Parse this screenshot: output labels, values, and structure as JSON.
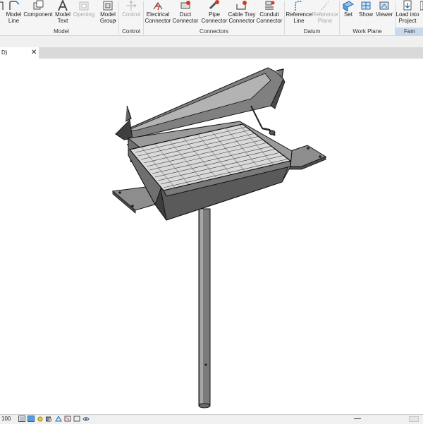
{
  "ribbon": {
    "buttons": {
      "model_line": "Model\nLine",
      "component": "Component",
      "model_text": "Model\nText",
      "opening": "Opening",
      "model_group": "Model\nGroup",
      "control": "Control",
      "electrical_connector": "Electrical\nConnector",
      "duct_connector": "Duct\nConnector",
      "pipe_connector": "Pipe\nConnector",
      "cable_tray_connector": "Cable Tray\nConnector",
      "conduit_connector": "Conduit\nConnector",
      "reference_line": "Reference\nLine",
      "reference_plane": "Reference\nPlane",
      "set": "Set",
      "show": "Show",
      "viewer": "Viewer",
      "load_into_project": "Load into\nProject"
    },
    "groups": {
      "model": "Model",
      "control": "Control",
      "connectors": "Connectors",
      "datum": "Datum",
      "work_plane": "Work Plane",
      "family_editor": "Fam"
    }
  },
  "view_tab": {
    "label": "D)",
    "close": "✕"
  },
  "status_bar": {
    "scale": "100"
  },
  "colors": {
    "ribbon_bg": "#f5f5f5",
    "accent_blue": "#1f6fb5",
    "tabbar": "#d9d9d9",
    "status_bg": "#f0f0f0"
  }
}
